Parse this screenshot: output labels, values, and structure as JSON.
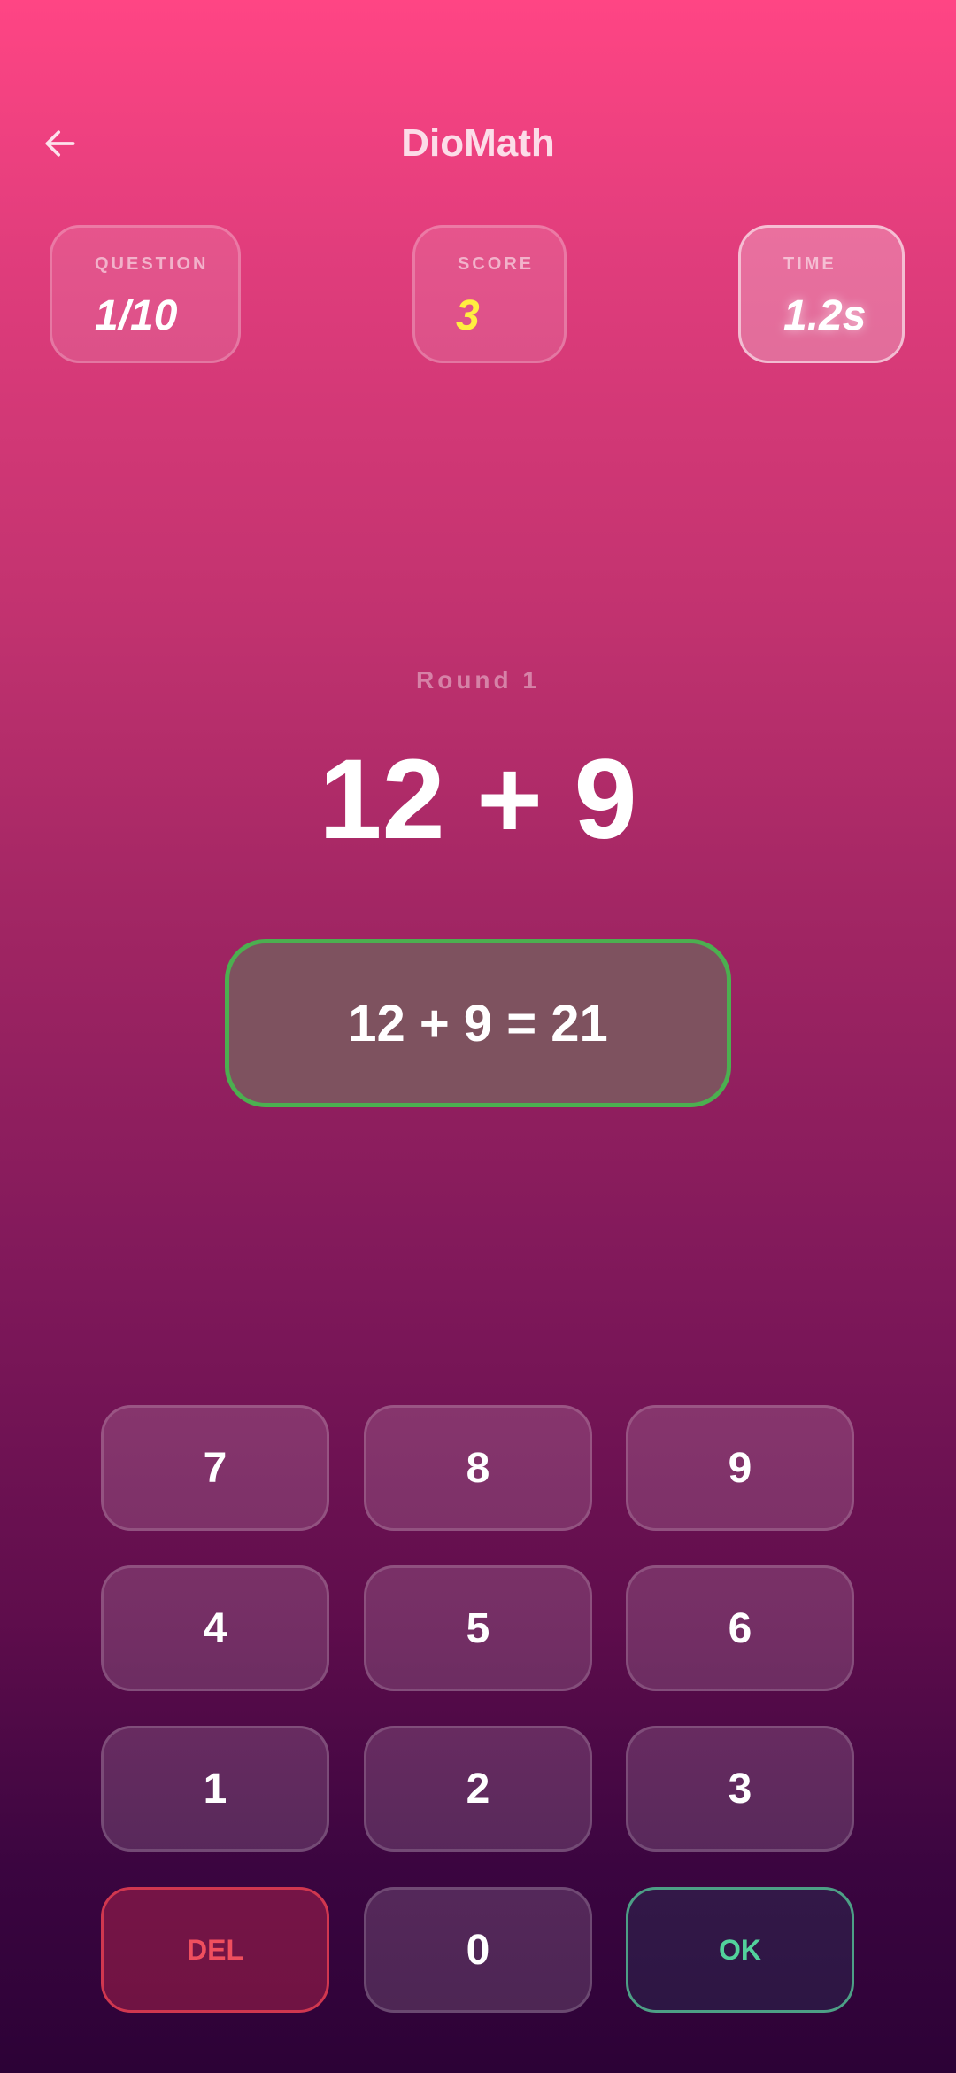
{
  "header": {
    "title": "DioMath",
    "back_icon": "arrow-left-icon"
  },
  "stats": {
    "question": {
      "label": "QUESTION",
      "value": "1/10"
    },
    "score": {
      "label": "SCORE",
      "value": "3",
      "color": "#ffee40"
    },
    "time": {
      "label": "TIME",
      "value": "1.2s"
    }
  },
  "game": {
    "round_label": "Round 1",
    "problem": "12 + 9",
    "answer": "12 + 9 = 21",
    "answer_border_color": "#4caf50"
  },
  "keypad": {
    "k7": "7",
    "k8": "8",
    "k9": "9",
    "k4": "4",
    "k5": "5",
    "k6": "6",
    "k1": "1",
    "k2": "2",
    "k3": "3",
    "del": "DEL",
    "k0": "0",
    "ok": "OK"
  },
  "colors": {
    "gradient_top": "#ff4584",
    "gradient_bottom": "#2c0236",
    "del": "#ef4f5e",
    "ok": "#52d19c"
  }
}
